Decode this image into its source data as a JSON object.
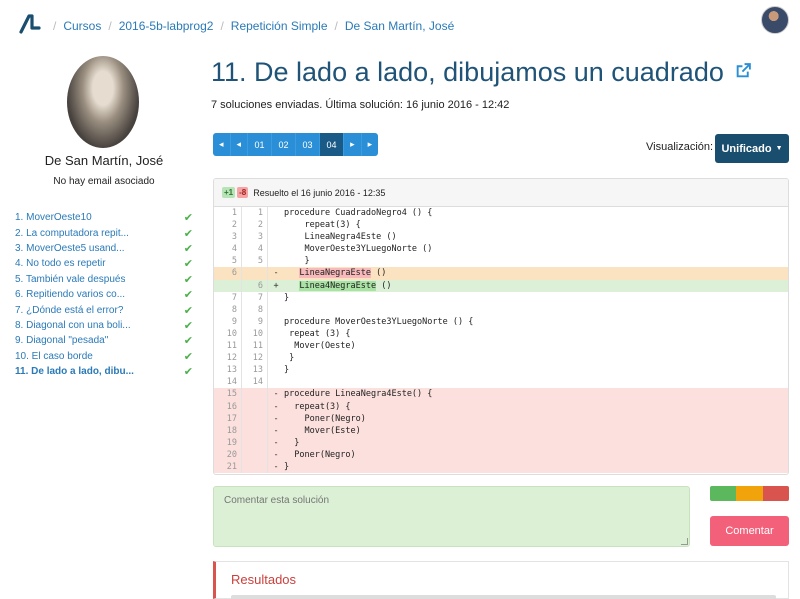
{
  "nav": {
    "breadcrumbs": [
      "Cursos",
      "2016-5b-labprog2",
      "Repetición Simple",
      "De San Martín, José"
    ]
  },
  "profile": {
    "name": "De San Martín, José",
    "email": "No hay email asociado"
  },
  "exercises": [
    {
      "label": "1. MoverOeste10",
      "done": true
    },
    {
      "label": "2. La computadora repit...",
      "done": true
    },
    {
      "label": "3. MoverOeste5 usand...",
      "done": true
    },
    {
      "label": "4. No todo es repetir",
      "done": true
    },
    {
      "label": "5. También vale después",
      "done": true
    },
    {
      "label": "6. Repitiendo varios co...",
      "done": true
    },
    {
      "label": "7. ¿Dónde está el error?",
      "done": true
    },
    {
      "label": "8. Diagonal con una boli...",
      "done": true
    },
    {
      "label": "9. Diagonal \"pesada\"",
      "done": true
    },
    {
      "label": "10. El caso borde",
      "done": true
    },
    {
      "label": "11. De lado a lado, dibu...",
      "done": true,
      "active": true
    }
  ],
  "main": {
    "title": "11. De lado a lado, dibujamos un cuadrado",
    "summary": "7 soluciones enviadas. Última solución: 16 junio 2016 - 12:42",
    "pager": {
      "first": "◂",
      "prev": "◂",
      "pages": [
        "01",
        "02",
        "03",
        "04"
      ],
      "active_page": "04",
      "next": "▸",
      "last": "▸"
    },
    "visualization": {
      "label": "Visualización:",
      "selected": "Unificado"
    }
  },
  "diff": {
    "added": "+1",
    "removed": "-8",
    "header": "Resuelto el 16 junio 2016 - 12:35",
    "lines": [
      {
        "l": "1",
        "r": "1",
        "m": "",
        "type": "ctx",
        "code": "procedure CuadradoNegro4 () {"
      },
      {
        "l": "2",
        "r": "2",
        "m": "",
        "type": "ctx",
        "code": "    repeat(3) {"
      },
      {
        "l": "3",
        "r": "3",
        "m": "",
        "type": "ctx",
        "code": "    LineaNegra4Este ()"
      },
      {
        "l": "4",
        "r": "4",
        "m": "",
        "type": "ctx",
        "code": "    MoverOeste3YLuegoNorte ()"
      },
      {
        "l": "5",
        "r": "5",
        "m": "",
        "type": "ctx",
        "code": "    }"
      },
      {
        "l": "6",
        "r": "",
        "m": "-",
        "type": "chg-del",
        "pre": "   ",
        "hl": "LineaNegraEste",
        "post": " ()"
      },
      {
        "l": "",
        "r": "6",
        "m": "+",
        "type": "chg-add",
        "pre": "   ",
        "hl": "Linea4NegraEste",
        "post": " ()"
      },
      {
        "l": "7",
        "r": "7",
        "m": "",
        "type": "ctx",
        "code": "}"
      },
      {
        "l": "8",
        "r": "8",
        "m": "",
        "type": "ctx",
        "code": ""
      },
      {
        "l": "9",
        "r": "9",
        "m": "",
        "type": "ctx",
        "code": "procedure MoverOeste3YLuegoNorte () {"
      },
      {
        "l": "10",
        "r": "10",
        "m": "",
        "type": "ctx",
        "code": " repeat (3) {"
      },
      {
        "l": "11",
        "r": "11",
        "m": "",
        "type": "ctx",
        "code": "  Mover(Oeste)"
      },
      {
        "l": "12",
        "r": "12",
        "m": "",
        "type": "ctx",
        "code": " }"
      },
      {
        "l": "13",
        "r": "13",
        "m": "",
        "type": "ctx",
        "code": "}"
      },
      {
        "l": "14",
        "r": "14",
        "m": "",
        "type": "ctx",
        "code": ""
      },
      {
        "l": "15",
        "r": "",
        "m": "-",
        "type": "del",
        "code": "procedure LineaNegra4Este() {"
      },
      {
        "l": "16",
        "r": "",
        "m": "-",
        "type": "del",
        "code": "  repeat(3) {"
      },
      {
        "l": "17",
        "r": "",
        "m": "-",
        "type": "del",
        "code": "    Poner(Negro)"
      },
      {
        "l": "18",
        "r": "",
        "m": "-",
        "type": "del",
        "code": "    Mover(Este)"
      },
      {
        "l": "19",
        "r": "",
        "m": "-",
        "type": "del",
        "code": "  }"
      },
      {
        "l": "20",
        "r": "",
        "m": "-",
        "type": "del",
        "code": "  Poner(Negro)"
      },
      {
        "l": "21",
        "r": "",
        "m": "-",
        "type": "del",
        "code": "}"
      }
    ]
  },
  "comment": {
    "placeholder": "Comentar esta solución",
    "button": "Comentar",
    "ratings": [
      "#5cb85c",
      "#f0a30a",
      "#d9534f"
    ]
  },
  "results": {
    "title": "Resultados"
  },
  "colors": {
    "link": "#2a7ab8",
    "title": "#1f5478",
    "pager": "#2a8fd6",
    "pager_active": "#1a5a86",
    "viz_button": "#1a4e6e",
    "comment_button": "#f3607a"
  }
}
